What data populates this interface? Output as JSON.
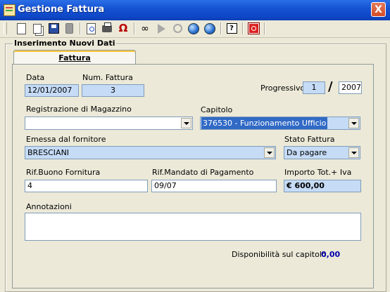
{
  "window": {
    "title": "Gestione Fattura",
    "close_label": "X"
  },
  "toolbar": {
    "buttons": [
      {
        "icon": "new-document-icon"
      },
      {
        "icon": "copy-document-icon"
      },
      {
        "icon": "save-icon"
      },
      {
        "icon": "delete-icon"
      },
      {
        "icon": "print-preview-icon"
      },
      {
        "icon": "printer-icon"
      },
      {
        "icon": "magnet-icon"
      },
      {
        "icon": "binoculars-icon"
      },
      {
        "icon": "play-icon"
      },
      {
        "icon": "search-icon"
      },
      {
        "icon": "globe-back-icon"
      },
      {
        "icon": "globe-forward-icon"
      },
      {
        "icon": "help-icon"
      },
      {
        "icon": "exit-icon"
      }
    ],
    "help_label": "?"
  },
  "group": {
    "label": "Inserimento Nuovi Dati"
  },
  "tab": {
    "label": "Fattura"
  },
  "form": {
    "data_label": "Data",
    "data_value": "12/01/2007",
    "num_label": "Num. Fattura",
    "num_value": "3",
    "progressivo_label": "Progressivo",
    "progressivo_value": "1",
    "progressivo_sep": "/",
    "anno_value": "2007",
    "magazzino_label": "Registrazione di Magazzino",
    "magazzino_value": "",
    "capitolo_label": "Capitolo",
    "capitolo_value": "376530 - Funzionamento Ufficio",
    "fornitore_label": "Emessa dal fornitore",
    "fornitore_value": "BRESCIANI",
    "stato_label": "Stato Fattura",
    "stato_value": "Da pagare",
    "buono_label": "Rif.Buono Fornitura",
    "buono_value": "4",
    "mandato_label": "Rif.Mandato di Pagamento",
    "mandato_value": "09/07",
    "importo_label": "Importo Tot.+ Iva",
    "importo_value": "€ 600,00",
    "annotazioni_label": "Annotazioni",
    "annotazioni_value": "",
    "disponibilita_label": "Disponibilità sul capitolo",
    "disponibilita_value": "0,00"
  },
  "colors": {
    "titlebar": "#0f48c7",
    "field_readonly": "#c5dbf6",
    "selection": "#316ac5",
    "value_blue": "#0000b0"
  }
}
